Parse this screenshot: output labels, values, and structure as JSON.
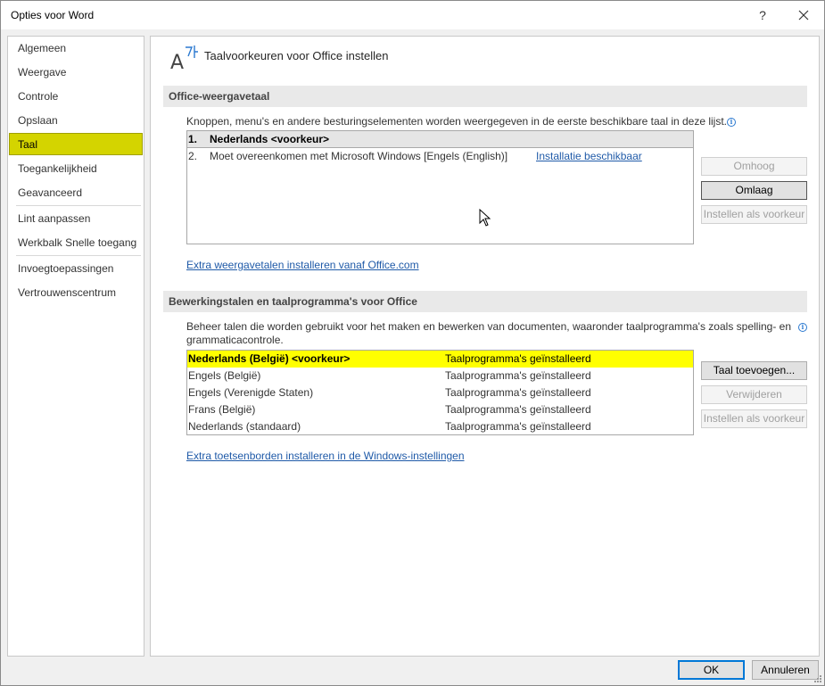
{
  "window": {
    "title": "Opties voor Word",
    "help_label": "?",
    "close_icon": "close-icon"
  },
  "nav": {
    "items": [
      {
        "label": "Algemeen"
      },
      {
        "label": "Weergave"
      },
      {
        "label": "Controle"
      },
      {
        "label": "Opslaan"
      },
      {
        "label": "Taal",
        "active": true
      },
      {
        "label": "Toegankelijkheid"
      },
      {
        "label": "Geavanceerd"
      },
      {
        "label": "Lint aanpassen"
      },
      {
        "label": "Werkbalk Snelle toegang"
      },
      {
        "label": "Invoegtoepassingen"
      },
      {
        "label": "Vertrouwenscentrum"
      }
    ],
    "active_color": "#d4d400"
  },
  "header": {
    "icon": "language-icon",
    "title": "Taalvoorkeuren voor Office instellen"
  },
  "display_language": {
    "section_title": "Office-weergavetaal",
    "description": "Knoppen, menu's en andere besturingselementen worden weergegeven in de eerste beschikbare taal in deze lijst.",
    "items": [
      {
        "num": "1.",
        "label": "Nederlands <voorkeur>",
        "link": ""
      },
      {
        "num": "2.",
        "label": "Moet overeenkomen met Microsoft Windows [Engels (English)]",
        "link": "Installatie beschikbaar"
      }
    ],
    "buttons": {
      "up": "Omhoog",
      "down": "Omlaag",
      "set_preferred": "Instellen als voorkeur"
    },
    "install_link": "Extra weergavetalen installeren vanaf Office.com"
  },
  "editing_language": {
    "section_title": "Bewerkingstalen en taalprogramma's voor Office",
    "description_line1": "Beheer talen die worden gebruikt voor het maken en bewerken van documenten, waaronder taalprogramma's zoals spelling- en",
    "description_line2": "grammaticacontrole.",
    "rows": [
      {
        "lang": "Nederlands (België) <voorkeur>",
        "status": "Taalprogramma's geïnstalleerd"
      },
      {
        "lang": "Engels (België)",
        "status": "Taalprogramma's geïnstalleerd"
      },
      {
        "lang": "Engels (Verenigde Staten)",
        "status": "Taalprogramma's geïnstalleerd"
      },
      {
        "lang": "Frans (België)",
        "status": "Taalprogramma's geïnstalleerd"
      },
      {
        "lang": "Nederlands (standaard)",
        "status": "Taalprogramma's geïnstalleerd"
      }
    ],
    "highlight_color": "#ffff00",
    "buttons": {
      "add": "Taal toevoegen...",
      "remove": "Verwijderen",
      "set_preferred": "Instellen als voorkeur"
    },
    "keyboard_link": "Extra toetsenborden installeren in de Windows-instellingen"
  },
  "footer": {
    "ok": "OK",
    "cancel": "Annuleren"
  }
}
